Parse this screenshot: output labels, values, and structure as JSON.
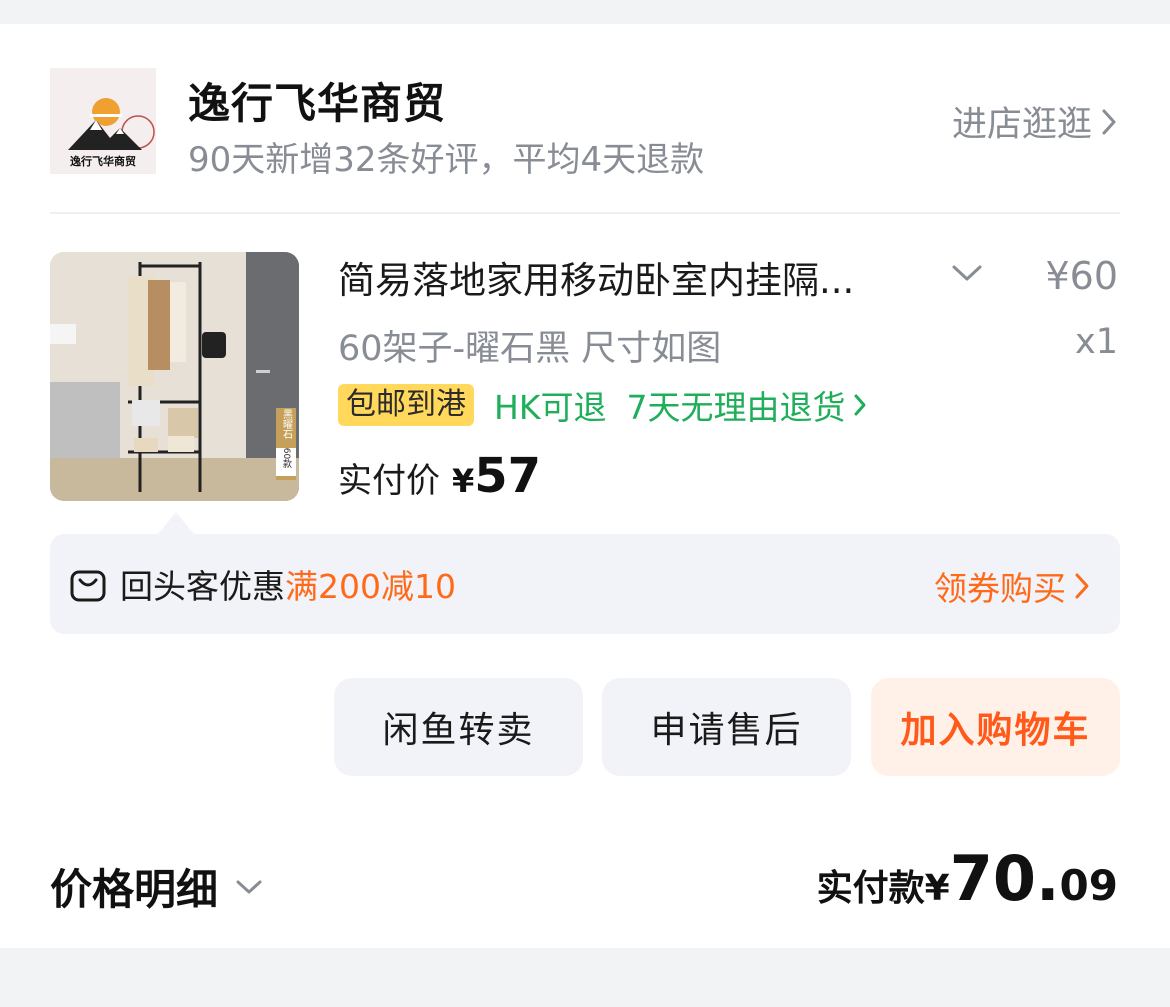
{
  "shop": {
    "name": "逸行飞华商贸",
    "subtitle": "90天新增32条好评，平均4天退款",
    "enter_label": "进店逛逛",
    "logo_text": "逸行飞华商贸"
  },
  "product": {
    "title": "简易落地家用移动卧室内挂隔...",
    "price": "¥60",
    "spec": "60架子-曜石黑 尺寸如图",
    "qty": "x1",
    "badge": "包邮到港",
    "return_hk": "HK可退",
    "return_7day": "7天无理由退货",
    "real_price_label": "实付价",
    "real_price_yen": "¥",
    "real_price_value": "57",
    "image_tag_color": "黑曜石",
    "image_tag_size": "60款"
  },
  "promo": {
    "prefix": "回头客优惠",
    "highlight": "满200减10",
    "action": "领券购买"
  },
  "buttons": {
    "resell": "闲鱼转卖",
    "aftersale": "申请售后",
    "add_cart": "加入购物车"
  },
  "summary": {
    "detail_label": "价格明细",
    "total_label": "实付款",
    "total_yen": "¥",
    "total_int": "70.",
    "total_dec": "09"
  },
  "colors": {
    "accent_orange": "#ff6a1a",
    "green": "#1fae5a",
    "badge_yellow": "#ffd85c",
    "muted_gray": "#888c94"
  }
}
